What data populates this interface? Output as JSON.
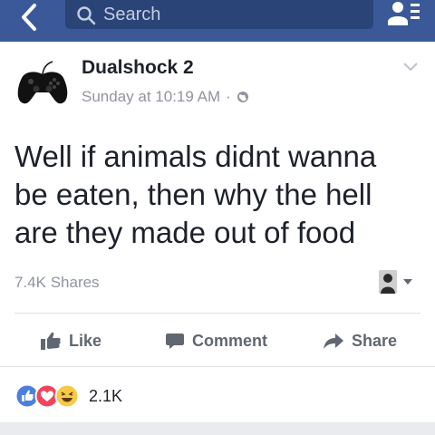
{
  "search": {
    "placeholder": "Search"
  },
  "post": {
    "author": "Dualshock 2",
    "timestamp": "Sunday at 10:19 AM",
    "separator": "·",
    "text_lines": [
      "Well if animals didnt wanna",
      "be eaten, then why the hell",
      "are they made out of food"
    ],
    "shares": "7.4K Shares",
    "reaction_count": "2.1K"
  },
  "actions": {
    "like": "Like",
    "comment": "Comment",
    "share": "Share"
  },
  "colors": {
    "brand": "#3b5998",
    "muted": "#90949c",
    "action": "#606770"
  }
}
